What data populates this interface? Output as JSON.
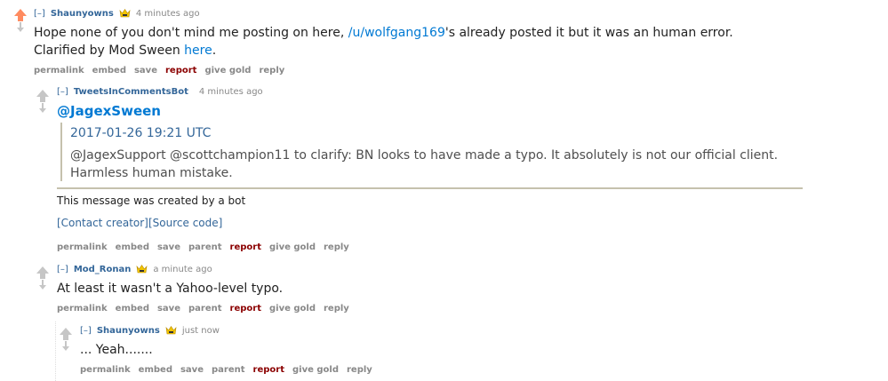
{
  "comment1": {
    "collapse": "[–]",
    "author": "Shaunyowns",
    "time": "4 minutes ago",
    "body_pre": "Hope none of you don't mind me posting on here, ",
    "body_link": "/u/wolfgang169",
    "body_post": "'s already posted it but it was an human error.",
    "body_line2_pre": "Clarified by Mod Sween ",
    "body_line2_link": "here",
    "body_line2_post": ".",
    "buttons": {
      "permalink": "permalink",
      "embed": "embed",
      "save": "save",
      "report": "report",
      "give_gold": "give gold",
      "reply": "reply"
    }
  },
  "comment2": {
    "collapse": "[–]",
    "author": "TweetsInCommentsBot",
    "time": "4 minutes ago",
    "handle": "@JagexSween",
    "quote_date": "2017-01-26 19:21 UTC",
    "quote_line1": "@JagexSupport @scottchampion11 to clarify: BN looks to have made a typo. It absolutely is not our official client.",
    "quote_line2": "Harmless human mistake.",
    "bot_note": "This message was created by a bot",
    "contact": "[Contact creator]",
    "source": "[Source code]",
    "buttons": {
      "permalink": "permalink",
      "embed": "embed",
      "save": "save",
      "parent": "parent",
      "report": "report",
      "give_gold": "give gold",
      "reply": "reply"
    }
  },
  "comment3": {
    "collapse": "[–]",
    "author": "Mod_Ronan",
    "time": "a minute ago",
    "body": "At least it wasn't a Yahoo-level typo.",
    "buttons": {
      "permalink": "permalink",
      "embed": "embed",
      "save": "save",
      "parent": "parent",
      "report": "report",
      "give_gold": "give gold",
      "reply": "reply"
    }
  },
  "comment4": {
    "collapse": "[–]",
    "author": "Shaunyowns",
    "time": "just now",
    "body": "... Yeah.......",
    "buttons": {
      "permalink": "permalink",
      "embed": "embed",
      "save": "save",
      "parent": "parent",
      "report": "report",
      "give_gold": "give gold",
      "reply": "reply"
    }
  },
  "colors": {
    "upvote": "#ff8b60",
    "link": "#0079d3",
    "author": "#336699",
    "report": "#8b0000"
  }
}
